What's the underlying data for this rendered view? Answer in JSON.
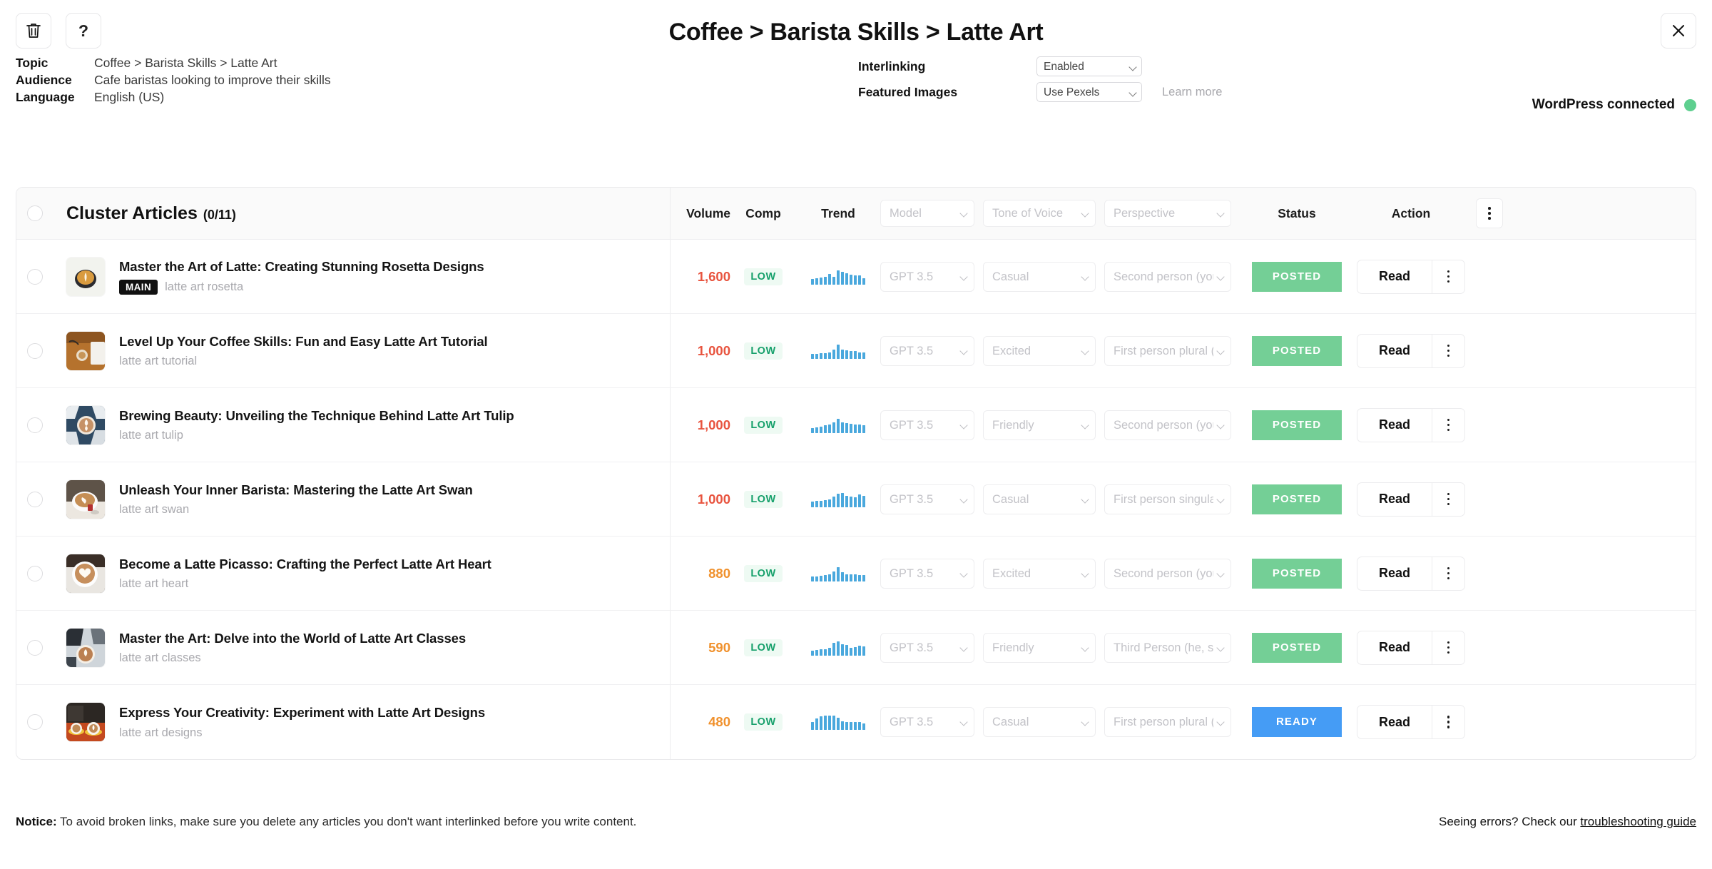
{
  "header": {
    "title": "Coffee > Barista Skills > Latte Art",
    "trash_icon": "trash-icon",
    "help_label": "?",
    "close_icon": "close-icon"
  },
  "meta": {
    "topic_label": "Topic",
    "topic_value": "Coffee > Barista Skills > Latte Art",
    "audience_label": "Audience",
    "audience_value": "Cafe baristas looking to improve their skills",
    "language_label": "Language",
    "language_value": "English (US)"
  },
  "config": {
    "interlinking_label": "Interlinking",
    "interlinking_value": "Enabled",
    "featured_images_label": "Featured Images",
    "featured_images_value": "Use Pexels",
    "learn_more": "Learn more",
    "wordpress_status": "WordPress connected",
    "wordpress_dot_color": "#5ecf8f"
  },
  "table": {
    "cluster_title": "Cluster Articles",
    "cluster_count": "(0/11)",
    "columns": {
      "volume": "Volume",
      "comp": "Comp",
      "trend": "Trend",
      "model": "Model",
      "tone": "Tone of Voice",
      "perspective": "Perspective",
      "status": "Status",
      "action": "Action"
    },
    "rows": [
      {
        "title": "Master the Art of Latte: Creating Stunning Rosetta Designs",
        "badge": "MAIN",
        "keyword": "latte art rosetta",
        "volume": "1,600",
        "volume_color": "red",
        "comp": "LOW",
        "trend": [
          6,
          7,
          8,
          9,
          12,
          9,
          16,
          14,
          13,
          11,
          10,
          10,
          7
        ],
        "model": "GPT 3.5",
        "tone": "Casual",
        "perspective": "Second person (you, your)",
        "status": "POSTED",
        "status_type": "posted",
        "action": "Read",
        "thumb": "latte-rosetta"
      },
      {
        "title": "Level Up Your Coffee Skills: Fun and Easy Latte Art Tutorial",
        "badge": "",
        "keyword": "latte art tutorial",
        "volume": "1,000",
        "volume_color": "red",
        "comp": "LOW",
        "trend": [
          6,
          6,
          7,
          7,
          8,
          11,
          17,
          11,
          10,
          9,
          9,
          8,
          8
        ],
        "model": "GPT 3.5",
        "tone": "Excited",
        "perspective": "First person plural (we, us)",
        "status": "POSTED",
        "status_type": "posted",
        "action": "Read",
        "thumb": "latte-tutorial"
      },
      {
        "title": "Brewing Beauty: Unveiling the Technique Behind Latte Art Tulip",
        "badge": "",
        "keyword": "latte art tulip",
        "volume": "1,000",
        "volume_color": "red",
        "comp": "LOW",
        "trend": [
          6,
          7,
          8,
          9,
          10,
          13,
          17,
          13,
          12,
          11,
          10,
          10,
          9
        ],
        "model": "GPT 3.5",
        "tone": "Friendly",
        "perspective": "Second person (you, your)",
        "status": "POSTED",
        "status_type": "posted",
        "action": "Read",
        "thumb": "latte-tulip"
      },
      {
        "title": "Unleash Your Inner Barista: Mastering the Latte Art Swan",
        "badge": "",
        "keyword": "latte art swan",
        "volume": "1,000",
        "volume_color": "red",
        "comp": "LOW",
        "trend": [
          6,
          7,
          7,
          8,
          9,
          12,
          15,
          16,
          13,
          12,
          11,
          14,
          13
        ],
        "model": "GPT 3.5",
        "tone": "Casual",
        "perspective": "First person singular (I, me)",
        "status": "POSTED",
        "status_type": "posted",
        "action": "Read",
        "thumb": "latte-swan"
      },
      {
        "title": "Become a Latte Picasso: Crafting the Perfect Latte Art Heart",
        "badge": "",
        "keyword": "latte art heart",
        "volume": "880",
        "volume_color": "orange",
        "comp": "LOW",
        "trend": [
          6,
          6,
          7,
          8,
          9,
          13,
          18,
          12,
          9,
          9,
          9,
          8,
          8
        ],
        "model": "GPT 3.5",
        "tone": "Excited",
        "perspective": "Second person (you, your)",
        "status": "POSTED",
        "status_type": "posted",
        "action": "Read",
        "thumb": "latte-heart"
      },
      {
        "title": "Master the Art: Delve into the World of Latte Art Classes",
        "badge": "",
        "keyword": "latte art classes",
        "volume": "590",
        "volume_color": "orange",
        "comp": "LOW",
        "trend": [
          6,
          7,
          8,
          8,
          9,
          15,
          17,
          14,
          13,
          9,
          10,
          12,
          11
        ],
        "model": "GPT 3.5",
        "tone": "Friendly",
        "perspective": "Third Person (he, she, it, they)",
        "status": "POSTED",
        "status_type": "posted",
        "action": "Read",
        "thumb": "latte-classes"
      },
      {
        "title": "Express Your Creativity: Experiment with Latte Art Designs",
        "badge": "",
        "keyword": "latte art designs",
        "volume": "480",
        "volume_color": "orange",
        "comp": "LOW",
        "trend": [
          8,
          12,
          14,
          15,
          15,
          15,
          13,
          9,
          8,
          8,
          8,
          8,
          7
        ],
        "model": "GPT 3.5",
        "tone": "Casual",
        "perspective": "First person plural (we, us)",
        "status": "READY",
        "status_type": "ready",
        "action": "Read",
        "thumb": "latte-designs"
      }
    ]
  },
  "footer": {
    "notice_label": "Notice:",
    "notice_text": " To avoid broken links, make sure you delete any articles you don't want interlinked before you write content.",
    "errors_text": "Seeing errors? Check our ",
    "errors_link": "troubleshooting guide"
  },
  "colors": {
    "posted": "#74cf96",
    "ready": "#459cf5",
    "volume_red": "#e8543f",
    "volume_orange": "#f0912d",
    "comp_green": "#16a06b",
    "spark": "#4aa8dd"
  }
}
